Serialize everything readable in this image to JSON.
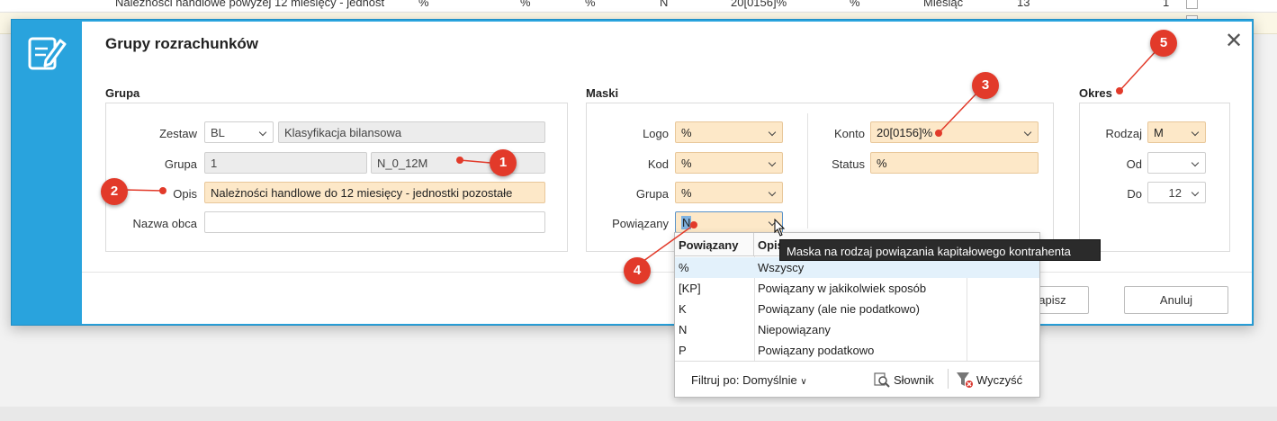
{
  "background_list": {
    "row_text": "Należności handlowe powyżej 12 miesięcy - jednost",
    "cells": [
      "%",
      "%",
      "%",
      "N",
      "20[0156]%",
      "%",
      "Miesiąc",
      "13",
      "1"
    ]
  },
  "dialog": {
    "title": "Grupy rozrachunków",
    "close_symbol": "✕"
  },
  "grupa": {
    "section_label": "Grupa",
    "zestaw_label": "Zestaw",
    "zestaw_value": "BL",
    "zestaw_desc": "Klasyfikacja bilansowa",
    "grupa_label": "Grupa",
    "grupa_value": "1",
    "grupa_code": "N_0_12M",
    "opis_label": "Opis",
    "opis_value": "Należności handlowe  do 12 miesięcy - jednostki pozostałe",
    "nazwa_obca_label": "Nazwa obca",
    "nazwa_obca_value": ""
  },
  "maski": {
    "section_label": "Maski",
    "logo_label": "Logo",
    "logo_value": "%",
    "kod_label": "Kod",
    "kod_value": "%",
    "grupa_label": "Grupa",
    "grupa_value": "%",
    "powiazany_label": "Powiązany",
    "powiazany_value": "N",
    "konto_label": "Konto",
    "konto_value": "20[0156]%",
    "status_label": "Status",
    "status_value": "%"
  },
  "okres": {
    "section_label": "Okres",
    "rodzaj_label": "Rodzaj",
    "rodzaj_value": "M",
    "od_label": "Od",
    "od_value": "",
    "do_label": "Do",
    "do_value": "12"
  },
  "buttons": {
    "save": "Zapisz",
    "cancel": "Anuluj"
  },
  "dropdown": {
    "col1_header": "Powiązany",
    "col2_header": "Opis",
    "rows": [
      {
        "code": "%",
        "desc": "Wszyscy"
      },
      {
        "code": "[KP]",
        "desc": "Powiązany w jakikolwiek sposób"
      },
      {
        "code": "K",
        "desc": "Powiązany (ale nie podatkowo)"
      },
      {
        "code": "N",
        "desc": "Niepowiązany"
      },
      {
        "code": "P",
        "desc": "Powiązany podatkowo"
      }
    ],
    "filter_label": "Filtruj po: Domyślnie",
    "slownik_label": "Słownik",
    "wyczysc_label": "Wyczyść"
  },
  "tooltip": "Maska na rodzaj powiązania kapitałowego kontrahenta",
  "markers": [
    "1",
    "2",
    "3",
    "4",
    "5"
  ],
  "colors": {
    "dialog_accent": "#29a3dd",
    "orange_field": "#fde8c8",
    "marker_red": "#e23a2a"
  },
  "icons": [
    "document-edit-icon",
    "close-icon",
    "chevron-down-icon",
    "magnifier-icon",
    "filter-clear-icon"
  ]
}
